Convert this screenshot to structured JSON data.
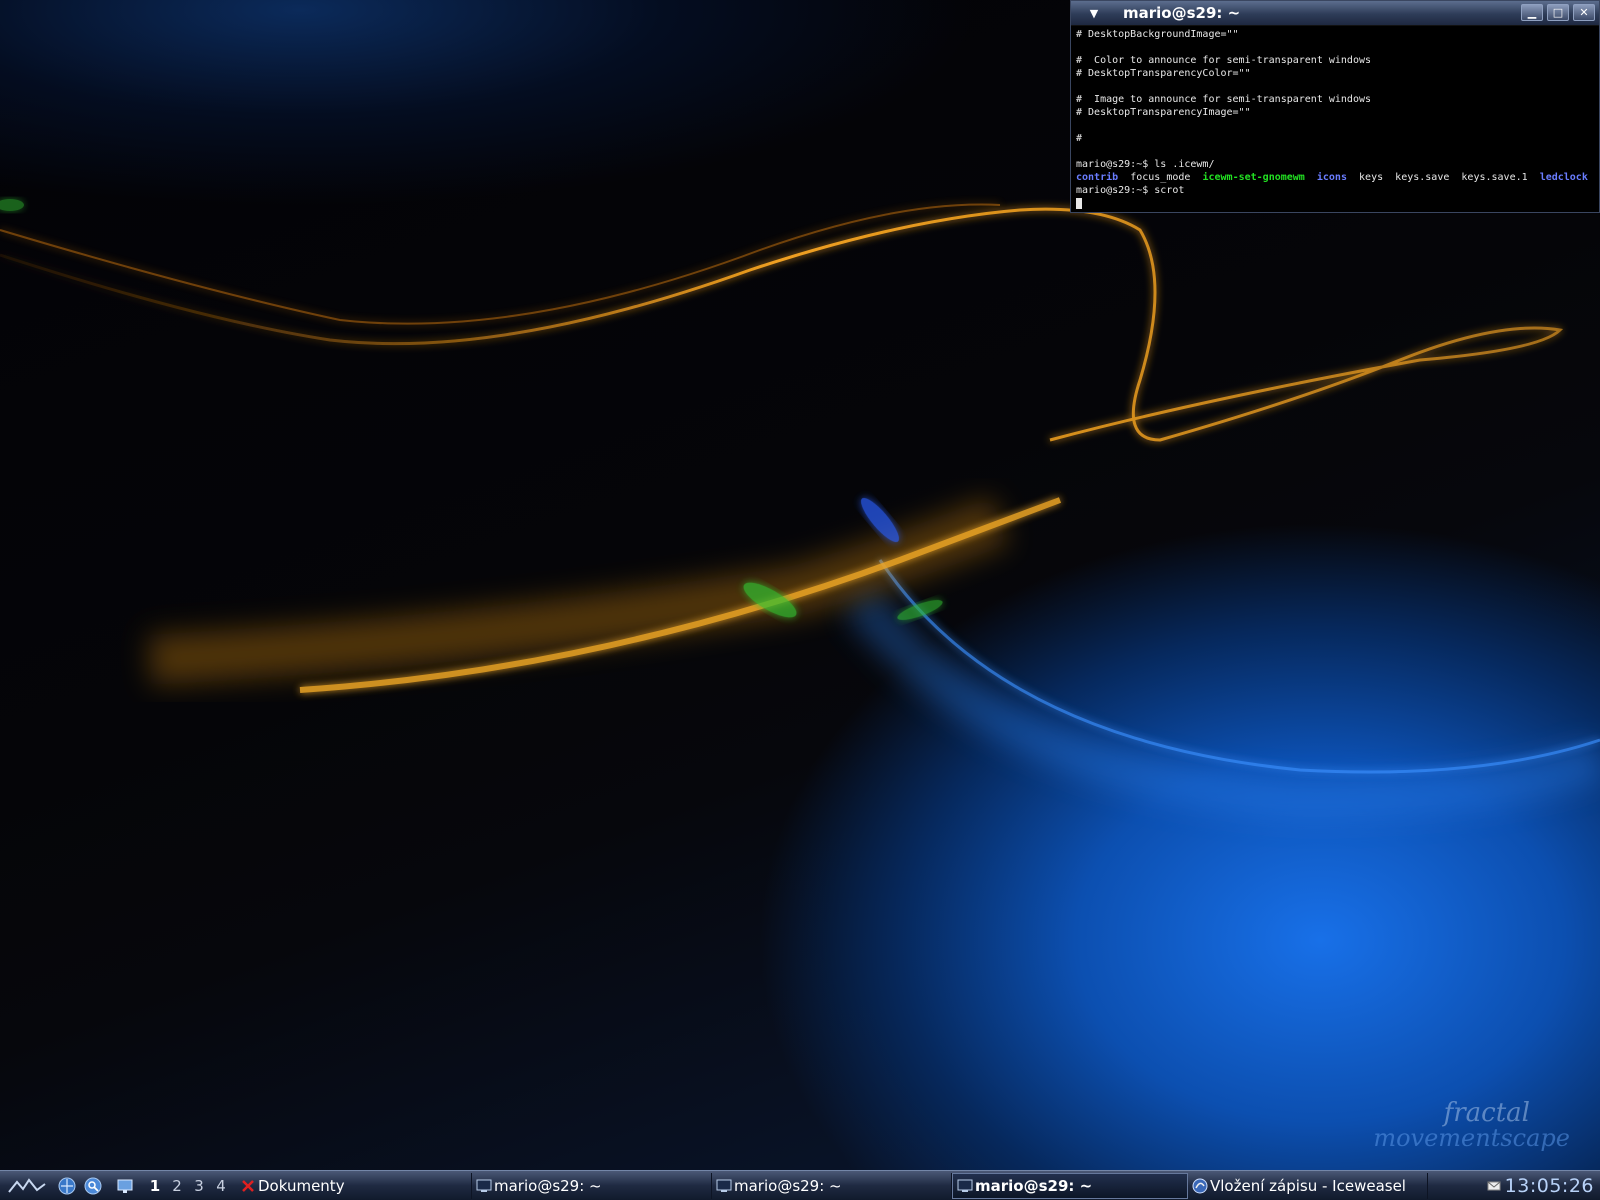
{
  "terminal": {
    "title": "mario@s29: ~",
    "menu_icon": "triangle-down-icon",
    "buttons": {
      "minimize": "minimize-icon",
      "maximize": "maximize-icon",
      "close": "close-icon"
    },
    "lines": [
      "# DesktopBackgroundImage=\"\"",
      "",
      "#  Color to announce for semi-transparent windows",
      "# DesktopTransparencyColor=\"\"",
      "",
      "#  Image to announce for semi-transparent windows",
      "# DesktopTransparencyImage=\"\"",
      "",
      "#",
      "",
      "mario@s29:~$ ls .icewm/"
    ],
    "ls_output": [
      {
        "name": "contrib",
        "kind": "dir"
      },
      {
        "name": "focus_mode",
        "kind": "file"
      },
      {
        "name": "icewm-set-gnomewm",
        "kind": "exec"
      },
      {
        "name": "icons",
        "kind": "dir"
      },
      {
        "name": "keys",
        "kind": "file"
      },
      {
        "name": "keys.save",
        "kind": "file"
      },
      {
        "name": "keys.save.1",
        "kind": "file"
      },
      {
        "name": "ledclock",
        "kind": "dir"
      }
    ],
    "last_prompt": "mario@s29:~$ scrot"
  },
  "wallpaper": {
    "signature_line1": "fractal",
    "signature_line2": "movementscape",
    "colors": {
      "orange": "#f0a020",
      "blue": "#1870e8",
      "green": "#30c030"
    }
  },
  "taskbar": {
    "start_icon": "icewm-logo-icon",
    "quick_launch": [
      {
        "name": "browser-launcher-icon"
      },
      {
        "name": "search-launcher-icon"
      },
      {
        "name": "show-desktop-icon"
      }
    ],
    "workspaces": [
      "1",
      "2",
      "3",
      "4"
    ],
    "active_workspace": "1",
    "tasks": [
      {
        "label": "Dokumenty",
        "icon": "red-x-icon",
        "active": false
      },
      {
        "label": "mario@s29: ~",
        "icon": "terminal-icon",
        "active": false
      },
      {
        "label": "mario@s29: ~",
        "icon": "terminal-icon",
        "active": false
      },
      {
        "label": "mario@s29: ~",
        "icon": "terminal-icon",
        "active": true
      },
      {
        "label": "Vložení zápisu - Iceweasel",
        "icon": "iceweasel-icon",
        "active": false
      }
    ],
    "mail_icon": "mail-icon",
    "clock": "13:05:26"
  }
}
